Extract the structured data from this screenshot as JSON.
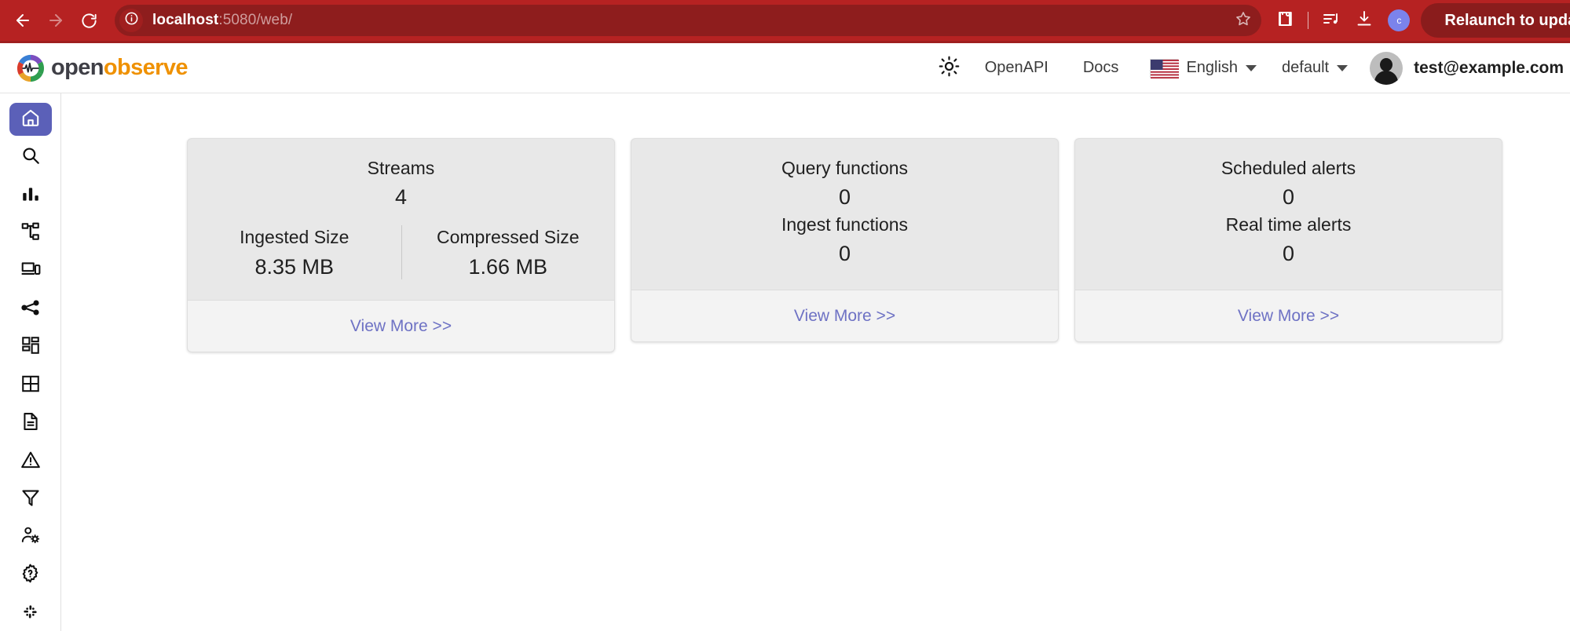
{
  "browser": {
    "back_icon": "arrow-left-icon",
    "forward_icon": "arrow-right-icon",
    "reload_icon": "reload-icon",
    "site_info_icon": "info-circle-icon",
    "url_host": "localhost",
    "url_path": ":5080/web/",
    "bookmark_icon": "star-icon",
    "extensions_icon": "puzzle-piece-icon",
    "media_icon": "media-playlist-icon",
    "downloads_icon": "download-icon",
    "profile_initial": "c",
    "relaunch_label": "Relaunch to update",
    "toolbar_color": "#b62222",
    "omnibox_color": "#8e1d1d"
  },
  "header": {
    "brand_first": "open",
    "brand_second": "observe",
    "brand_mark_icon": "openobserve-pulse-logo",
    "theme_toggle_icon": "sun-icon",
    "openapi_label": "OpenAPI",
    "docs_label": "Docs",
    "flag_icon": "us-flag-icon",
    "language_label": "English",
    "language_caret_icon": "chevron-down-icon",
    "org_label": "default",
    "org_caret_icon": "chevron-down-icon",
    "avatar_icon": "user-avatar",
    "user_email": "test@example.com",
    "user_caret_icon": "chevron-down-icon"
  },
  "sidebar": {
    "items": [
      {
        "name": "home",
        "icon": "home-icon",
        "active": true
      },
      {
        "name": "search",
        "icon": "search-icon",
        "active": false
      },
      {
        "name": "metrics",
        "icon": "bar-chart-icon",
        "active": false
      },
      {
        "name": "pipelines",
        "icon": "hierarchy-icon",
        "active": false
      },
      {
        "name": "rum",
        "icon": "devices-icon",
        "active": false
      },
      {
        "name": "traces",
        "icon": "share-nodes-icon",
        "active": false
      },
      {
        "name": "dashboards",
        "icon": "dashboard-grid-icon",
        "active": false
      },
      {
        "name": "streams",
        "icon": "table-grid-icon",
        "active": false
      },
      {
        "name": "logs",
        "icon": "document-icon",
        "active": false
      },
      {
        "name": "alerts",
        "icon": "alert-triangle-icon",
        "active": false
      },
      {
        "name": "functions",
        "icon": "funnel-icon",
        "active": false
      },
      {
        "name": "iam",
        "icon": "user-settings-icon",
        "active": false
      },
      {
        "name": "management",
        "icon": "gear-question-icon",
        "active": false
      },
      {
        "name": "slack",
        "icon": "slack-icon",
        "active": false
      }
    ]
  },
  "main": {
    "view_more_label": "View More >>",
    "accent_link_color": "#6e72c4",
    "cards": [
      {
        "title": "Streams",
        "value": "4",
        "split": [
          {
            "label": "Ingested Size",
            "value": "8.35 MB"
          },
          {
            "label": "Compressed Size",
            "value": "1.66 MB"
          }
        ]
      },
      {
        "title": "Query functions",
        "value": "0",
        "second_title": "Ingest functions",
        "second_value": "0"
      },
      {
        "title": "Scheduled alerts",
        "value": "0",
        "second_title": "Real time alerts",
        "second_value": "0"
      }
    ]
  }
}
